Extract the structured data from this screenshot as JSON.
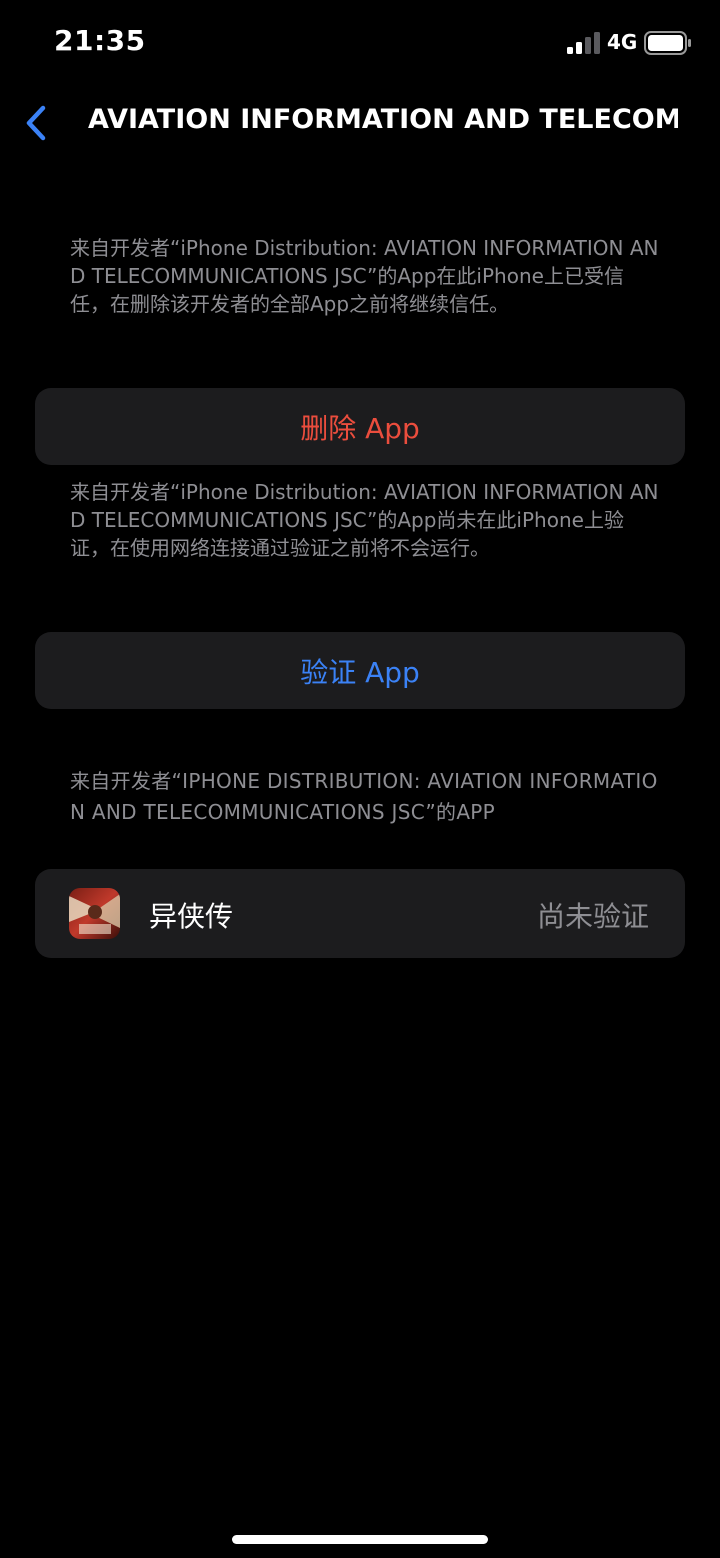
{
  "status_bar": {
    "time": "21:35",
    "network": "4G",
    "signal_icon": "cellular-signal-icon",
    "battery_icon": "battery-icon"
  },
  "nav": {
    "back_icon": "chevron-left-icon",
    "title": "AVIATION INFORMATION AND TELECOM..."
  },
  "trust_note": "来自开发者“iPhone Distribution: AVIATION INFORMATION AND TELECOMMUNICATIONS JSC”的App在此iPhone上已受信任，在删除该开发者的全部App之前将继续信任。",
  "delete_button": "删除 App",
  "verify_note": "来自开发者“iPhone Distribution: AVIATION INFORMATION AND TELECOMMUNICATIONS JSC”的App尚未在此iPhone上验证，在使用网络连接通过验证之前将不会运行。",
  "verify_button": "验证 App",
  "apps_section_header": "来自开发者“IPHONE DISTRIBUTION: AVIATION INFORMATION AND TELECOMMUNICATIONS JSC”的APP",
  "apps": [
    {
      "name": "异侠传",
      "status": "尚未验证",
      "icon": "app-icon"
    }
  ],
  "colors": {
    "background": "#000000",
    "card": "#1c1c1e",
    "destructive": "#eb4d3d",
    "accent": "#3b82f6",
    "secondary_text": "#8e8e93"
  }
}
